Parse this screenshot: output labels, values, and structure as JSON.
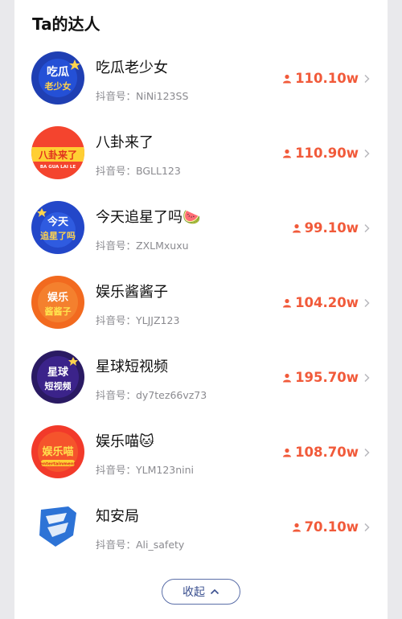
{
  "section": {
    "title": "Ta的达人"
  },
  "colors": {
    "accent": "#f15a3a",
    "muted": "#8a8a8f",
    "button_border": "#5a6ea8"
  },
  "influencers": [
    {
      "name": "吃瓜老少女",
      "handle": "抖音号：NiNi123SS",
      "followers": "110.10w",
      "avatar_icon": "chigua-avatar",
      "avatar_text": [
        "吃瓜",
        "老少女"
      ]
    },
    {
      "name": "八卦来了",
      "handle": "抖音号：BGLL123",
      "followers": "110.90w",
      "avatar_icon": "bagua-avatar",
      "avatar_text": [
        "八卦来了",
        "BA GUA LAI LE"
      ]
    },
    {
      "name": "今天追星了吗🍉",
      "handle": "抖音号：ZXLMxuxu",
      "followers": "99.10w",
      "avatar_icon": "zhuixing-avatar",
      "avatar_text": [
        "今天",
        "追星了吗"
      ]
    },
    {
      "name": "娱乐酱酱子",
      "handle": "抖音号：YLJJZ123",
      "followers": "104.20w",
      "avatar_icon": "yule-avatar",
      "avatar_text": [
        "娱乐",
        "酱酱子"
      ]
    },
    {
      "name": "星球短视频",
      "handle": "抖音号：dy7tez66vz73",
      "followers": "195.70w",
      "avatar_icon": "xingqiu-avatar",
      "avatar_text": [
        "星球",
        "短视频"
      ]
    },
    {
      "name": "娱乐喵🐱",
      "handle": "抖音号：YLM123nini",
      "followers": "108.70w",
      "avatar_icon": "yulemiao-avatar",
      "avatar_text": [
        "娱乐喵",
        "entertainment"
      ]
    },
    {
      "name": "知安局",
      "handle": "抖音号：Ali_safety",
      "followers": "70.10w",
      "avatar_icon": "zhianju-shield-avatar"
    }
  ],
  "collapse_button": {
    "label": "收起"
  }
}
